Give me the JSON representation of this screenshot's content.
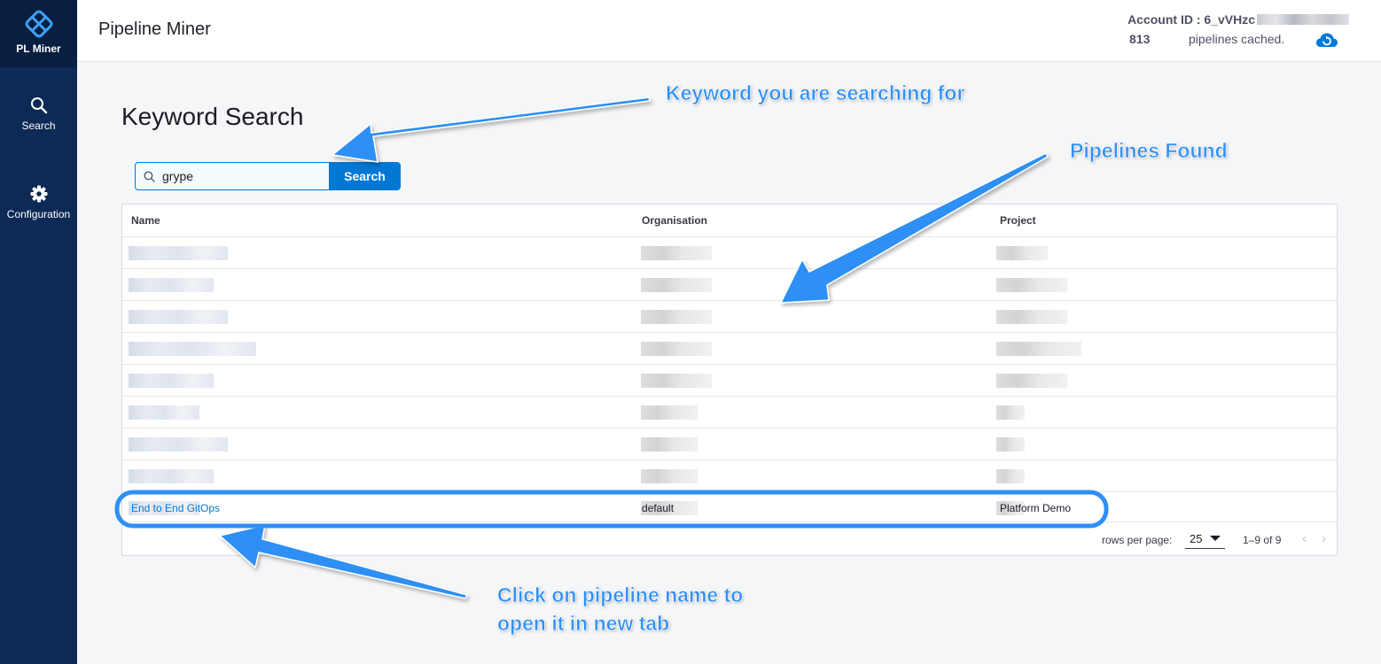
{
  "sidebar": {
    "brand_label": "PL Miner",
    "items": [
      {
        "label": "Search",
        "icon": "search-icon"
      },
      {
        "label": "Configuration",
        "icon": "gear-icon"
      }
    ]
  },
  "header": {
    "title": "Pipeline Miner",
    "account_label": "Account ID : 6_vVHzc",
    "cached_count": "813",
    "cached_label": "pipelines cached.",
    "refresh_icon": "refresh-cloud-icon"
  },
  "main": {
    "page_title": "Keyword Search",
    "search": {
      "value": "grype",
      "button_label": "Search"
    }
  },
  "table": {
    "columns": [
      "Name",
      "Organisation",
      "Project"
    ],
    "visible_row": {
      "name": "End to End GitOps",
      "organisation": "default",
      "project": "Platform Demo"
    },
    "footer": {
      "rows_per_page_label": "rows per page:",
      "rows_per_page_value": "25",
      "range": "1–9 of 9"
    }
  },
  "annotations": {
    "keyword": "Keyword you are searching for",
    "found": "Pipelines Found",
    "click_line1": "Click on pipeline name to",
    "click_line2": "open it in new tab"
  },
  "colors": {
    "sidebar": "#0c2a55",
    "primary": "#0278d5",
    "annotation": "#2e8ff5"
  }
}
